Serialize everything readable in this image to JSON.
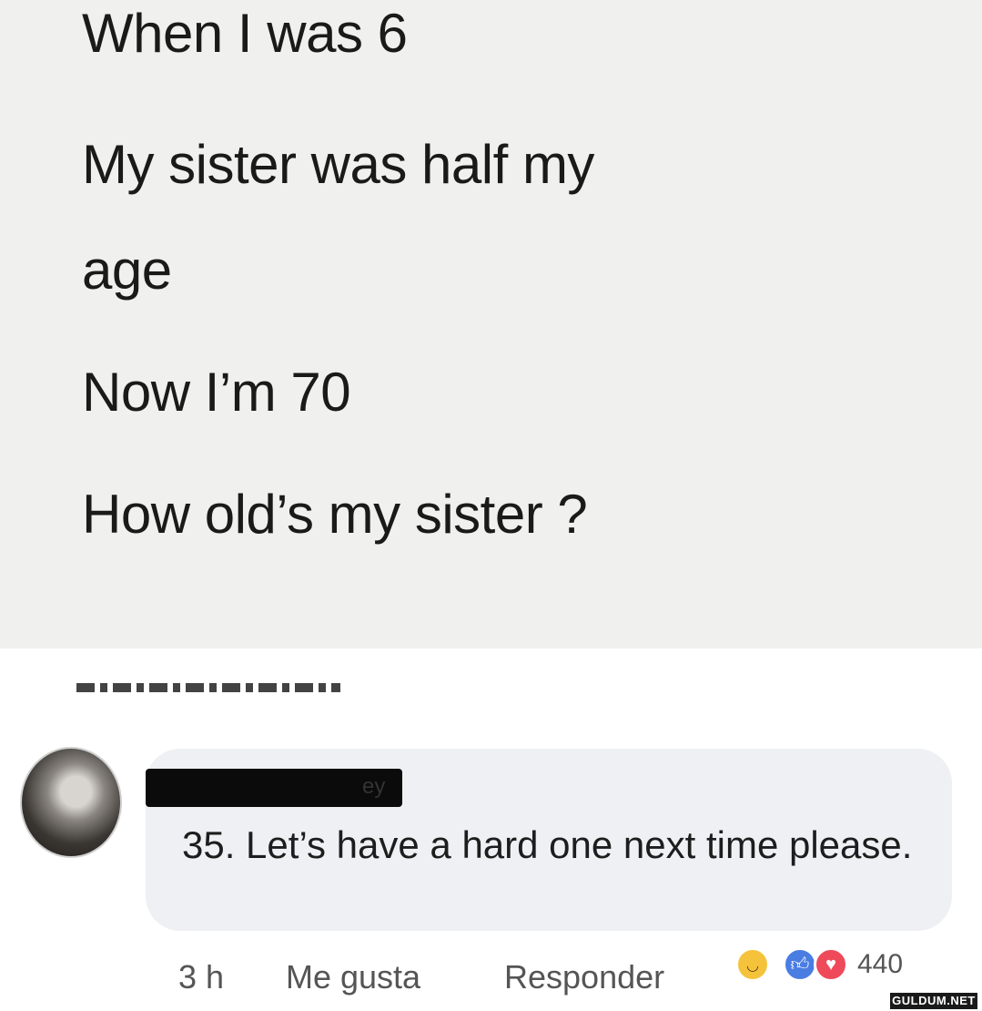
{
  "post": {
    "lines": [
      "When I was 6",
      "My sister was half my",
      "age",
      "Now I’m 70",
      "How old’s my sister ?"
    ]
  },
  "comment": {
    "author_visible_fragment": "ey",
    "text": "35. Let’s have a hard one next time please.",
    "actions": {
      "time": "3 h",
      "like": "Me gusta",
      "reply": "Responder"
    },
    "reactions": {
      "icons": [
        "haha-icon",
        "like-icon",
        "love-icon"
      ],
      "count": "440"
    }
  },
  "watermark": "GULDUM.NET",
  "colors": {
    "post_background": "#f0f0ee",
    "bubble_background": "#eff0f3",
    "like_blue": "#4a7de2",
    "love_red": "#ef4a5a",
    "haha_yellow": "#f5c33b"
  }
}
